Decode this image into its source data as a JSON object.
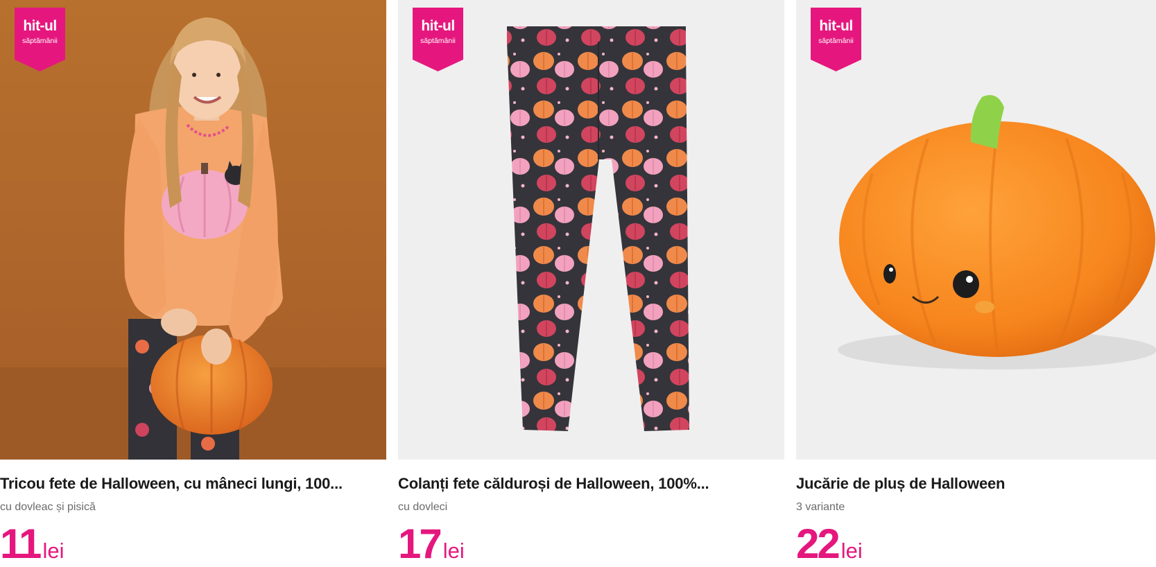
{
  "theme": {
    "accent": "#e5177e",
    "title_color": "#1a1a1a",
    "subtitle_color": "#6b6b6b"
  },
  "products": [
    {
      "badge": {
        "title": "hit-ul",
        "subtitle": "săptămânii"
      },
      "image": "girl-in-halloween-pumpkin-tshirt-holding-pumpkin-plush",
      "title": "Tricou fete de Halloween, cu mâneci lungi, 100...",
      "subtitle": "cu dovleac și pisică",
      "price": {
        "amount": "11",
        "currency": "lei"
      }
    },
    {
      "badge": {
        "title": "hit-ul",
        "subtitle": "săptămânii"
      },
      "image": "dark-leggings-with-pumpkin-print",
      "title": "Colanți fete călduroși de Halloween, 100%...",
      "subtitle": "cu dovleci",
      "price": {
        "amount": "17",
        "currency": "lei"
      }
    },
    {
      "badge": {
        "title": "hit-ul",
        "subtitle": "săptămânii"
      },
      "image": "orange-pumpkin-plush-toy",
      "title": "Jucărie de pluș de Halloween",
      "subtitle": "3 variante",
      "price": {
        "amount": "22",
        "currency": "lei"
      }
    }
  ]
}
